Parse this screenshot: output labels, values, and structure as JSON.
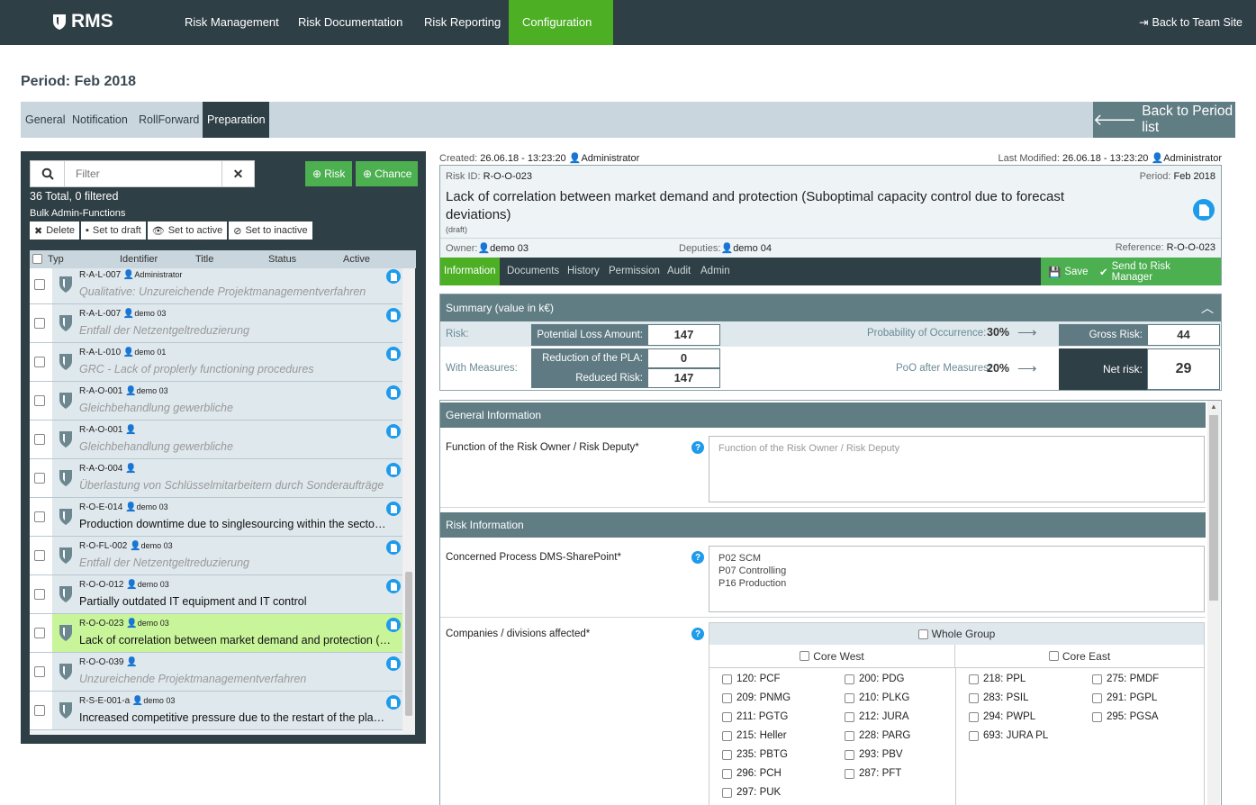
{
  "app": {
    "logo": "RMS",
    "back_team": "Back to Team Site"
  },
  "topnav": [
    {
      "label": "Risk Management"
    },
    {
      "label": "Risk Documentation"
    },
    {
      "label": "Risk Reporting"
    },
    {
      "label": "Configuration"
    }
  ],
  "period_title": "Period: Feb 2018",
  "tabs": [
    {
      "label": "General"
    },
    {
      "label": "Notification"
    },
    {
      "label": "RollForward"
    },
    {
      "label": "Preparation"
    }
  ],
  "back_period": "Back to Period list",
  "left": {
    "filter_placeholder": "Filter",
    "risk_btn": "Risk",
    "chance_btn": "Chance",
    "totals": "36 Total, 0 filtered",
    "bulk_label": "Bulk Admin-Functions",
    "bulk": [
      "Delete",
      "Set to draft",
      "Set to active",
      "Set to inactive"
    ],
    "columns": [
      "Typ",
      "Identifier",
      "Title",
      "Status",
      "Active"
    ],
    "rows": [
      {
        "id": "R-A-L-007",
        "user": "Administrator",
        "title": "Qualitative: Unzureichende Projektmanagementverfahren"
      },
      {
        "id": "R-A-L-007",
        "user": "demo 03",
        "title": "Entfall der Netzentgeltreduzierung"
      },
      {
        "id": "R-A-L-010",
        "user": "demo 01",
        "title": "GRC - Lack of proplerly functioning procedures"
      },
      {
        "id": "R-A-O-001",
        "user": "demo 03",
        "title": "Gleichbehandlung gewerbliche"
      },
      {
        "id": "R-A-O-001",
        "user": "",
        "title": "Gleichbehandlung gewerbliche"
      },
      {
        "id": "R-A-O-004",
        "user": "",
        "title": "Überlastung von Schlüsselmitarbeitern durch Sonderaufträge"
      },
      {
        "id": "R-O-E-014",
        "user": "demo 03",
        "title": "Production downtime due to singlesourcing within the secto…"
      },
      {
        "id": "R-O-FL-002",
        "user": "demo 03",
        "title": "Entfall der Netzentgeltreduzierung"
      },
      {
        "id": "R-O-O-012",
        "user": "demo 03",
        "title": "Partially outdated IT equipment and IT control"
      },
      {
        "id": "R-O-O-023",
        "user": "demo 03",
        "title": "Lack of correlation between market demand and protection (…"
      },
      {
        "id": "R-O-O-039",
        "user": "",
        "title": "Unzureichende Projektmanagementverfahren"
      },
      {
        "id": "R-S-E-001-a",
        "user": "demo 03",
        "title": "Increased competitive pressure due to the restart of the pla…"
      }
    ]
  },
  "detail": {
    "created_label": "Created:",
    "created": "26.06.18 - 13:23:20",
    "created_by": "Administrator",
    "modified_label": "Last Modified:",
    "modified": "26.06.18 - 13:23:20",
    "modified_by": "Administrator",
    "risk_id_label": "Risk ID:",
    "risk_id": "R-O-O-023",
    "period_label": "Period:",
    "period": "Feb 2018",
    "title": "Lack of correlation between market demand and protection (Suboptimal capacity control due to forecast deviations)",
    "state": "(draft)",
    "owner_label": "Owner:",
    "owner": "demo 03",
    "deputies_label": "Deputies:",
    "deputies": "demo 04",
    "reference_label": "Reference:",
    "reference": "R-O-O-023",
    "tabs": [
      "Information",
      "Documents",
      "History",
      "Permission",
      "Audit",
      "Admin"
    ],
    "save": "Save",
    "send": "Send to Risk Manager"
  },
  "summary": {
    "title": "Summary (value in k€)",
    "risk_label": "Risk:",
    "with_label": "With Measures:",
    "pla_label": "Potential Loss Amount:",
    "pla": "147",
    "red_label": "Reduction of the PLA:",
    "red": "0",
    "reduced_label": "Reduced Risk:",
    "reduced": "147",
    "poo_label": "Probability of Occurrence:",
    "poo": "30%",
    "poo_after_label": "PoO after Measures:",
    "poo_after": "20%",
    "gross_label": "Gross Risk:",
    "gross": "44",
    "net_label": "Net risk:",
    "net": "29"
  },
  "form": {
    "general_title": "General Information",
    "func_label": "Function of the Risk Owner / Risk Deputy*",
    "func_placeholder": "Function of the Risk Owner / Risk Deputy",
    "risk_info_title": "Risk Information",
    "process_label": "Concerned Process DMS-SharePoint*",
    "process_lines": [
      "P02 SCM",
      "P07 Controlling",
      "P16 Production"
    ],
    "companies_label": "Companies / divisions affected*",
    "whole_group": "Whole Group",
    "core_west": "Core West",
    "core_east": "Core East",
    "west_a": [
      "120: PCF",
      "209: PNMG",
      "211: PGTG",
      "215: Heller",
      "235: PBTG",
      "296: PCH",
      "297: PUK"
    ],
    "west_b": [
      "200: PDG",
      "210: PLKG",
      "212: JURA",
      "228: PARG",
      "293: PBV",
      "287: PFT"
    ],
    "east_a": [
      "218: PPL",
      "283: PSIL",
      "294: PWPL",
      "693: JURA PL"
    ],
    "east_b": [
      "275: PMDF",
      "291: PGPL",
      "295: PGSA"
    ]
  }
}
